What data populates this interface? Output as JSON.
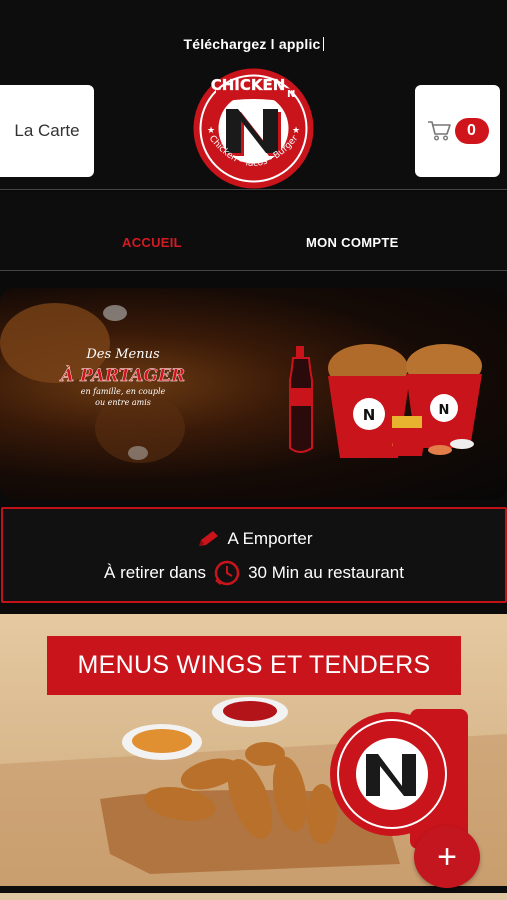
{
  "header": {
    "marquee_text": "Téléchargez l applic",
    "menu_button_label": "La Carte",
    "cart_count": "0",
    "logo": {
      "brand": "CHICKEN",
      "monogram": "N",
      "tagline": "Chicken - Tacos - Burger"
    }
  },
  "nav": {
    "items": [
      {
        "label": "ACCUEIL",
        "active": true
      },
      {
        "label": "MON COMPTE",
        "active": false
      }
    ]
  },
  "banner": {
    "line1": "Des Menus",
    "line2": "À PARTAGER",
    "line3": "en famille, en couple",
    "line4": "ou entre amis"
  },
  "pickup": {
    "mode_label": "A Emporter",
    "prefix": "À retirer dans",
    "suffix": "30 Min au restaurant"
  },
  "menu_card": {
    "title": "MENUS WINGS ET TENDERS",
    "add_label": "+"
  },
  "colors": {
    "brand_red": "#c9141c",
    "background": "#0d0d0d",
    "active_nav": "#d41a22"
  }
}
